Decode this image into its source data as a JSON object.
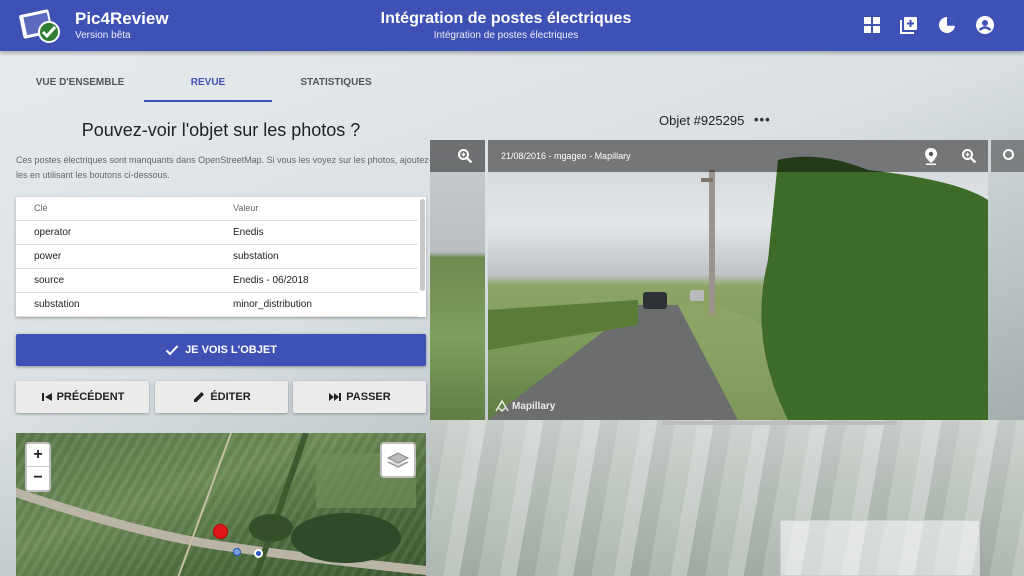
{
  "header": {
    "app_title": "Pic4Review",
    "app_subtitle": "Version bêta",
    "project_title": "Intégration de postes électriques",
    "project_subtitle": "Intégration de postes électriques",
    "icons": [
      "dashboard-icon",
      "add-box-icon",
      "pie-chart-icon",
      "account-icon"
    ],
    "color": "#3f51b5"
  },
  "tabs": [
    {
      "label": "VUE D'ENSEMBLE",
      "active": false
    },
    {
      "label": "REVUE",
      "active": true
    },
    {
      "label": "STATISTIQUES",
      "active": false
    }
  ],
  "review": {
    "question": "Pouvez-voir l'objet sur les photos ?",
    "description": "Ces postes électriques sont manquants dans OpenStreetMap. Si vous les voyez sur les photos, ajoutez-les en utilisant les boutons ci-dessous."
  },
  "table": {
    "headers": {
      "key": "Clé",
      "value": "Valeur"
    },
    "rows": [
      {
        "key": "operator",
        "value": "Enedis"
      },
      {
        "key": "power",
        "value": "substation"
      },
      {
        "key": "source",
        "value": "Enedis - 06/2018"
      },
      {
        "key": "substation",
        "value": "minor_distribution"
      }
    ]
  },
  "buttons": {
    "see": "JE VOIS L'OBJET",
    "previous": "PRÉCÉDENT",
    "edit": "ÉDITER",
    "skip": "PASSER"
  },
  "map": {
    "zoom_in": "+",
    "zoom_out": "−"
  },
  "object": {
    "title": "Objet #925295",
    "more": "•••"
  },
  "photos": {
    "main_caption": "21/08/2016 - mgageo - Mapillary",
    "watermark": "Mapillary"
  }
}
